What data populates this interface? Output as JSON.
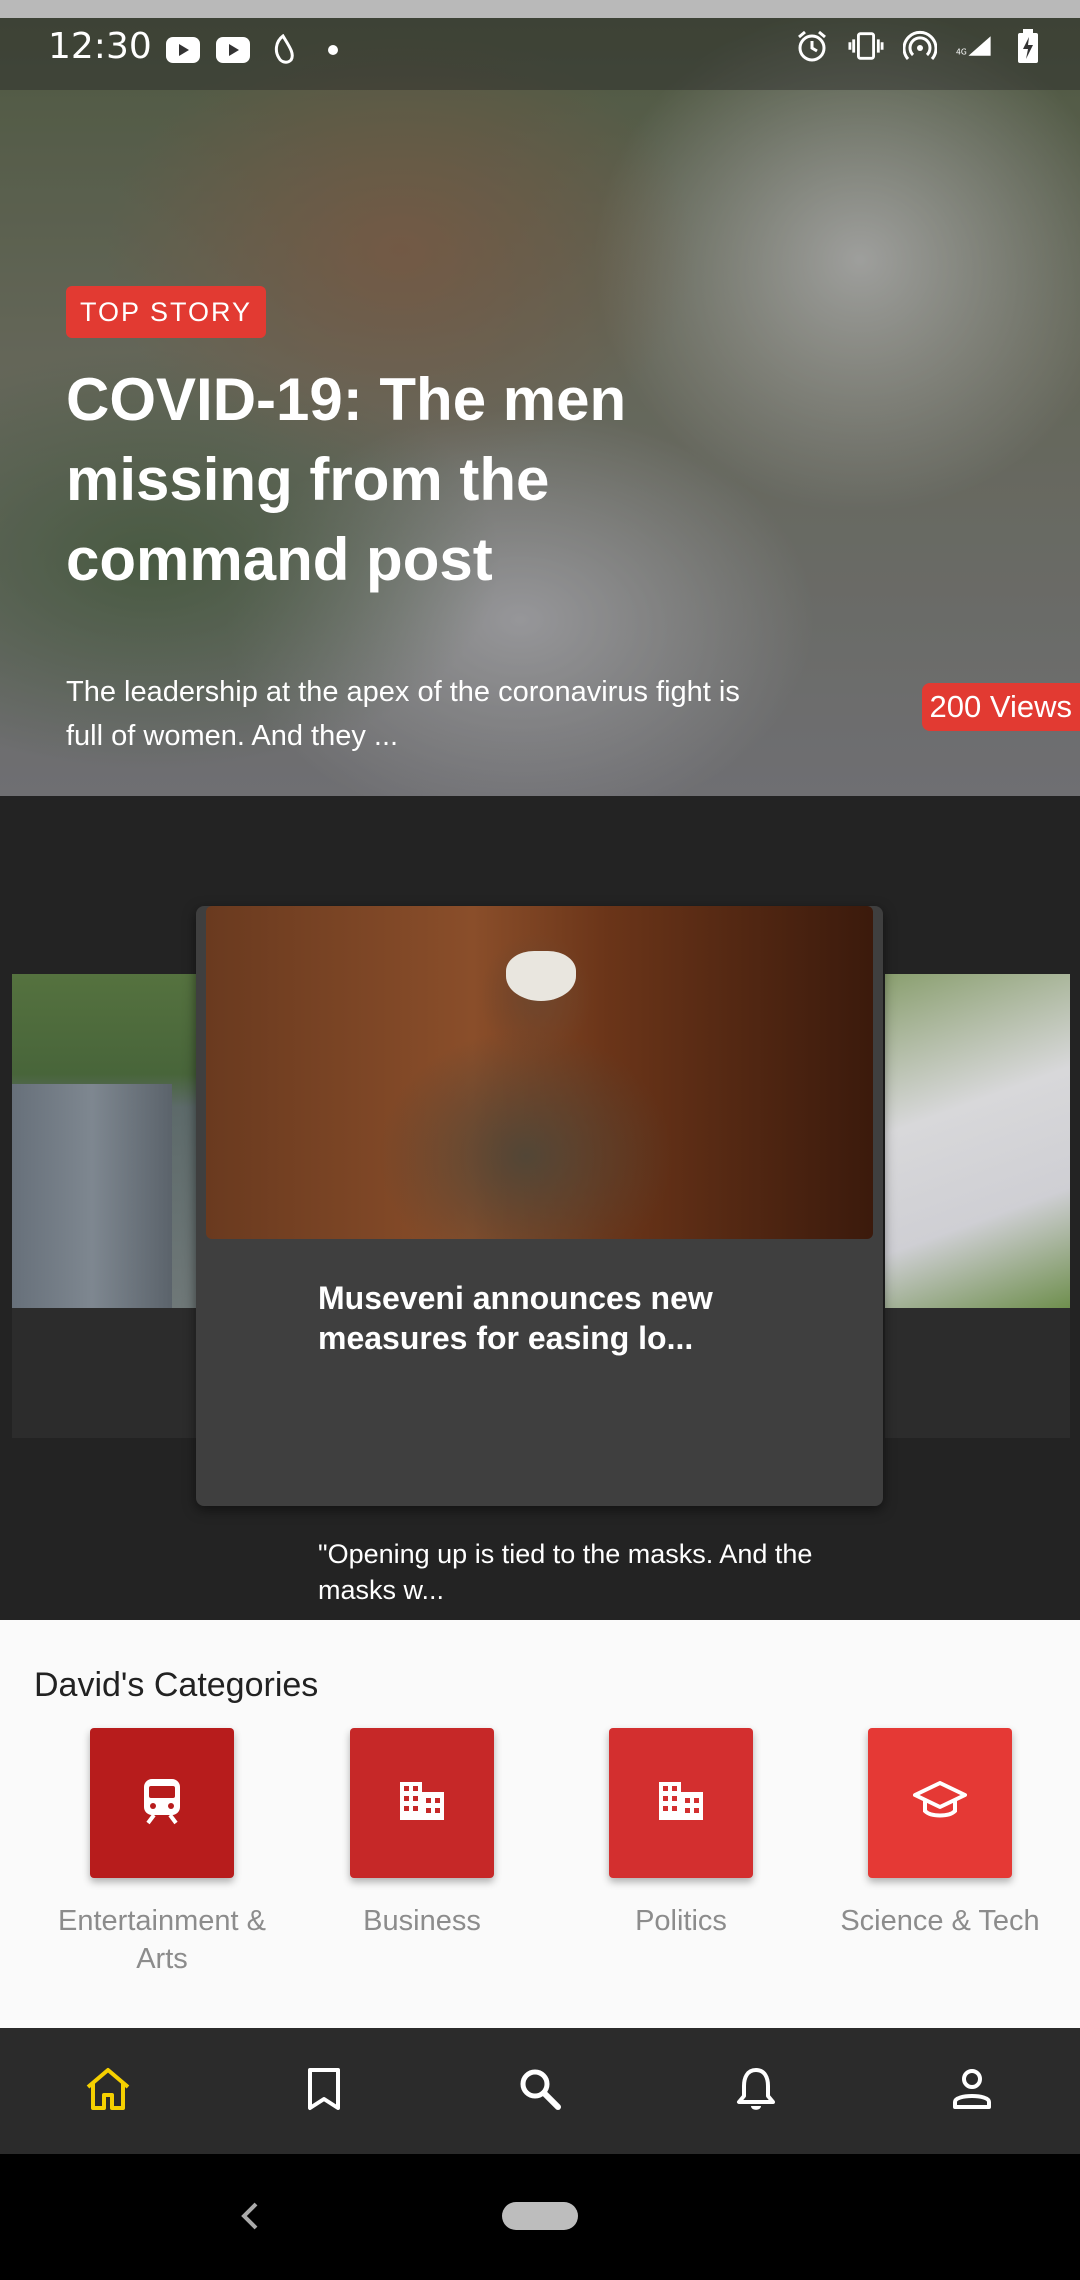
{
  "status_bar": {
    "time": "12:30",
    "left_icons": [
      "youtube-icon",
      "youtube-icon",
      "al-jazeera-icon",
      "dot-icon"
    ],
    "right_icons": [
      "alarm-icon",
      "vibrate-icon",
      "hotspot-icon",
      "network-4g-icon",
      "signal-icon",
      "battery-charging-icon"
    ]
  },
  "hero": {
    "badge": "TOP STORY",
    "title": "COVID-19: The men missing from the command post",
    "summary": "The leadership at the apex of the coronavirus fight is full of women. And they ...",
    "views": "200 Views"
  },
  "carousel": {
    "active_card": {
      "title": "Museveni announces new measures for easing lo...",
      "summary": "\"Opening up is tied to the masks. And the masks w..."
    }
  },
  "categories": {
    "heading": "David's Categories",
    "items": [
      {
        "label": "Entertainment & Arts",
        "icon": "train-icon",
        "color": "#b71c1c"
      },
      {
        "label": "Business",
        "icon": "building-icon",
        "color": "#c62828"
      },
      {
        "label": "Politics",
        "icon": "building-icon",
        "color": "#d32f2f"
      },
      {
        "label": "Science & Tech",
        "icon": "graduation-cap-icon",
        "color": "#e53935"
      }
    ]
  },
  "bottom_nav": {
    "items": [
      "home-icon",
      "bookmark-icon",
      "search-icon",
      "bell-icon",
      "account-icon"
    ],
    "active_color": "#f5d000",
    "inactive_color": "#ffffff"
  }
}
